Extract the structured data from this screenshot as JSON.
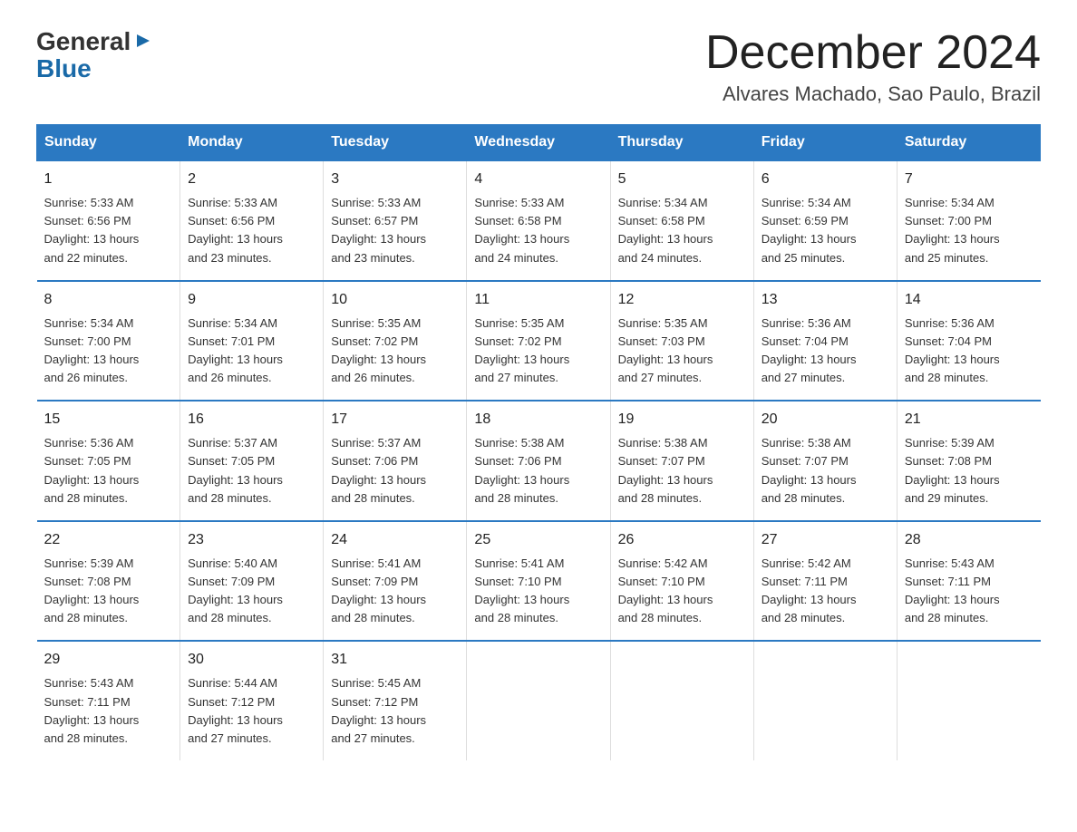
{
  "logo": {
    "general": "General",
    "arrow": "▶",
    "blue": "Blue"
  },
  "title": "December 2024",
  "subtitle": "Alvares Machado, Sao Paulo, Brazil",
  "days_header": [
    "Sunday",
    "Monday",
    "Tuesday",
    "Wednesday",
    "Thursday",
    "Friday",
    "Saturday"
  ],
  "weeks": [
    [
      {
        "day": "1",
        "info": "Sunrise: 5:33 AM\nSunset: 6:56 PM\nDaylight: 13 hours\nand 22 minutes."
      },
      {
        "day": "2",
        "info": "Sunrise: 5:33 AM\nSunset: 6:56 PM\nDaylight: 13 hours\nand 23 minutes."
      },
      {
        "day": "3",
        "info": "Sunrise: 5:33 AM\nSunset: 6:57 PM\nDaylight: 13 hours\nand 23 minutes."
      },
      {
        "day": "4",
        "info": "Sunrise: 5:33 AM\nSunset: 6:58 PM\nDaylight: 13 hours\nand 24 minutes."
      },
      {
        "day": "5",
        "info": "Sunrise: 5:34 AM\nSunset: 6:58 PM\nDaylight: 13 hours\nand 24 minutes."
      },
      {
        "day": "6",
        "info": "Sunrise: 5:34 AM\nSunset: 6:59 PM\nDaylight: 13 hours\nand 25 minutes."
      },
      {
        "day": "7",
        "info": "Sunrise: 5:34 AM\nSunset: 7:00 PM\nDaylight: 13 hours\nand 25 minutes."
      }
    ],
    [
      {
        "day": "8",
        "info": "Sunrise: 5:34 AM\nSunset: 7:00 PM\nDaylight: 13 hours\nand 26 minutes."
      },
      {
        "day": "9",
        "info": "Sunrise: 5:34 AM\nSunset: 7:01 PM\nDaylight: 13 hours\nand 26 minutes."
      },
      {
        "day": "10",
        "info": "Sunrise: 5:35 AM\nSunset: 7:02 PM\nDaylight: 13 hours\nand 26 minutes."
      },
      {
        "day": "11",
        "info": "Sunrise: 5:35 AM\nSunset: 7:02 PM\nDaylight: 13 hours\nand 27 minutes."
      },
      {
        "day": "12",
        "info": "Sunrise: 5:35 AM\nSunset: 7:03 PM\nDaylight: 13 hours\nand 27 minutes."
      },
      {
        "day": "13",
        "info": "Sunrise: 5:36 AM\nSunset: 7:04 PM\nDaylight: 13 hours\nand 27 minutes."
      },
      {
        "day": "14",
        "info": "Sunrise: 5:36 AM\nSunset: 7:04 PM\nDaylight: 13 hours\nand 28 minutes."
      }
    ],
    [
      {
        "day": "15",
        "info": "Sunrise: 5:36 AM\nSunset: 7:05 PM\nDaylight: 13 hours\nand 28 minutes."
      },
      {
        "day": "16",
        "info": "Sunrise: 5:37 AM\nSunset: 7:05 PM\nDaylight: 13 hours\nand 28 minutes."
      },
      {
        "day": "17",
        "info": "Sunrise: 5:37 AM\nSunset: 7:06 PM\nDaylight: 13 hours\nand 28 minutes."
      },
      {
        "day": "18",
        "info": "Sunrise: 5:38 AM\nSunset: 7:06 PM\nDaylight: 13 hours\nand 28 minutes."
      },
      {
        "day": "19",
        "info": "Sunrise: 5:38 AM\nSunset: 7:07 PM\nDaylight: 13 hours\nand 28 minutes."
      },
      {
        "day": "20",
        "info": "Sunrise: 5:38 AM\nSunset: 7:07 PM\nDaylight: 13 hours\nand 28 minutes."
      },
      {
        "day": "21",
        "info": "Sunrise: 5:39 AM\nSunset: 7:08 PM\nDaylight: 13 hours\nand 29 minutes."
      }
    ],
    [
      {
        "day": "22",
        "info": "Sunrise: 5:39 AM\nSunset: 7:08 PM\nDaylight: 13 hours\nand 28 minutes."
      },
      {
        "day": "23",
        "info": "Sunrise: 5:40 AM\nSunset: 7:09 PM\nDaylight: 13 hours\nand 28 minutes."
      },
      {
        "day": "24",
        "info": "Sunrise: 5:41 AM\nSunset: 7:09 PM\nDaylight: 13 hours\nand 28 minutes."
      },
      {
        "day": "25",
        "info": "Sunrise: 5:41 AM\nSunset: 7:10 PM\nDaylight: 13 hours\nand 28 minutes."
      },
      {
        "day": "26",
        "info": "Sunrise: 5:42 AM\nSunset: 7:10 PM\nDaylight: 13 hours\nand 28 minutes."
      },
      {
        "day": "27",
        "info": "Sunrise: 5:42 AM\nSunset: 7:11 PM\nDaylight: 13 hours\nand 28 minutes."
      },
      {
        "day": "28",
        "info": "Sunrise: 5:43 AM\nSunset: 7:11 PM\nDaylight: 13 hours\nand 28 minutes."
      }
    ],
    [
      {
        "day": "29",
        "info": "Sunrise: 5:43 AM\nSunset: 7:11 PM\nDaylight: 13 hours\nand 28 minutes."
      },
      {
        "day": "30",
        "info": "Sunrise: 5:44 AM\nSunset: 7:12 PM\nDaylight: 13 hours\nand 27 minutes."
      },
      {
        "day": "31",
        "info": "Sunrise: 5:45 AM\nSunset: 7:12 PM\nDaylight: 13 hours\nand 27 minutes."
      },
      {
        "day": "",
        "info": ""
      },
      {
        "day": "",
        "info": ""
      },
      {
        "day": "",
        "info": ""
      },
      {
        "day": "",
        "info": ""
      }
    ]
  ]
}
